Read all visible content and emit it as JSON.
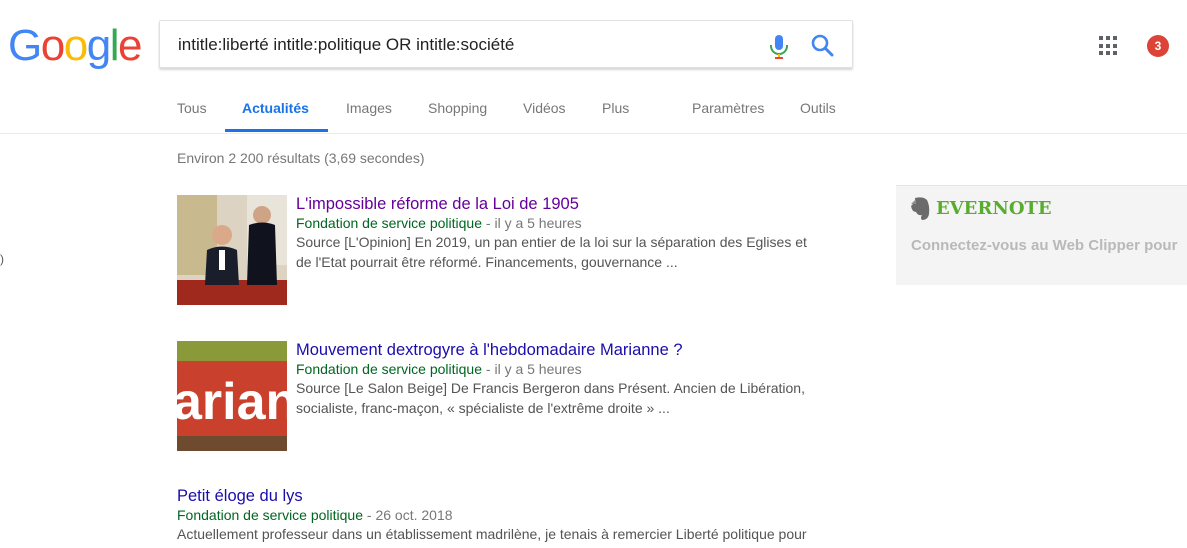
{
  "logo": [
    "G",
    "o",
    "o",
    "g",
    "l",
    "e"
  ],
  "logo_colors": [
    "#4285f4",
    "#ea4335",
    "#fbbc05",
    "#4285f4",
    "#34a853",
    "#ea4335"
  ],
  "search": {
    "value": "intitle:liberté intitle:politique OR intitle:société"
  },
  "header": {
    "notification_count": "3",
    "accent_color": "#1a73e8"
  },
  "tabs": [
    {
      "label": "Tous"
    },
    {
      "label": "Actualités",
      "active": true
    },
    {
      "label": "Images"
    },
    {
      "label": "Shopping"
    },
    {
      "label": "Vidéos"
    },
    {
      "label": "Plus"
    },
    {
      "label": "Paramètres"
    },
    {
      "label": "Outils"
    }
  ],
  "stats": "Environ 2 200 résultats (3,69 secondes)",
  "results": [
    {
      "title": "L'impossible réforme de la Loi de 1905",
      "source": "Fondation de service politique",
      "date": " - il y a 5 heures",
      "snippet_1": "Source [L'Opinion] En 2019, un pan entier de la loi sur la séparation des Eglises et",
      "snippet_2": "de l'Etat pourrait être réformé. Financements, gouvernance ..."
    },
    {
      "title": "Mouvement dextrogyre à l'hebdomadaire Marianne ?",
      "source": "Fondation de service politique",
      "date": " - il y a 5 heures",
      "snippet_1": "Source [Le Salon Beige] De Francis Bergeron dans Présent. Ancien de Libération,",
      "snippet_2": "socialiste, franc-maçon, « spécialiste de l'extrême droite » ...",
      "thumb_text": "arian"
    },
    {
      "title": "Petit éloge du lys",
      "source": "Fondation de service politique",
      "date": " - 26 oct. 2018",
      "snippet_1": "Actuellement professeur dans un établissement madrilène, je tenais à remercier Liberté politique pour"
    }
  ],
  "evernote": {
    "brand": "EVERNOTE",
    "message": "Connectez-vous au Web Clipper pour",
    "brand_color": "#5fb336"
  },
  "stray_char": ")"
}
